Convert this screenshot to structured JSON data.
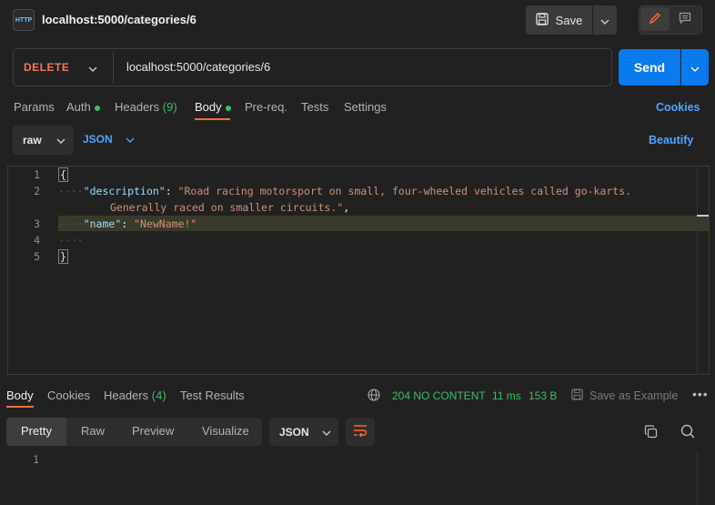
{
  "header": {
    "icon_label": "HTTP",
    "title": "localhost:5000/categories/6",
    "save_label": "Save"
  },
  "request": {
    "method": "DELETE",
    "url": "localhost:5000/categories/6",
    "send_label": "Send"
  },
  "tabs": {
    "params": "Params",
    "auth": "Auth",
    "headers": "Headers",
    "headers_count": "(9)",
    "body": "Body",
    "prereq": "Pre-req.",
    "tests": "Tests",
    "settings": "Settings",
    "cookies": "Cookies"
  },
  "body_options": {
    "mode": "raw",
    "language": "JSON",
    "beautify": "Beautify"
  },
  "editor": {
    "line_numbers": [
      "1",
      "2",
      "",
      "3",
      "4",
      "5"
    ],
    "open_brace": "{",
    "description_key": "\"description\"",
    "description_value_1": "\"Road racing motorsport on small, four-wheeled vehicles called go-karts.",
    "description_value_2": "Generally raced on smaller circuits.\"",
    "name_key": "\"name\"",
    "name_value": "\"NewName!\"",
    "close_brace": "}"
  },
  "response": {
    "tabs": {
      "body": "Body",
      "cookies": "Cookies",
      "headers": "Headers",
      "headers_count": "(4)",
      "test_results": "Test Results"
    },
    "status": "204 NO CONTENT",
    "time": "11 ms",
    "size": "153 B",
    "save_example": "Save as Example",
    "views": {
      "pretty": "Pretty",
      "raw": "Raw",
      "preview": "Preview",
      "visualize": "Visualize"
    },
    "format": "JSON",
    "line_numbers": [
      "1"
    ]
  },
  "colors": {
    "accent_orange": "#ff6c37",
    "send_blue": "#097bed",
    "status_green": "#3bbf6a",
    "method_delete": "#f0775a"
  },
  "icons": [
    "http-icon",
    "save-icon",
    "chevron-down-icon",
    "pencil-icon",
    "comment-icon",
    "globe-icon",
    "more-icon",
    "wrap-lines-icon",
    "copy-icon",
    "search-icon"
  ]
}
